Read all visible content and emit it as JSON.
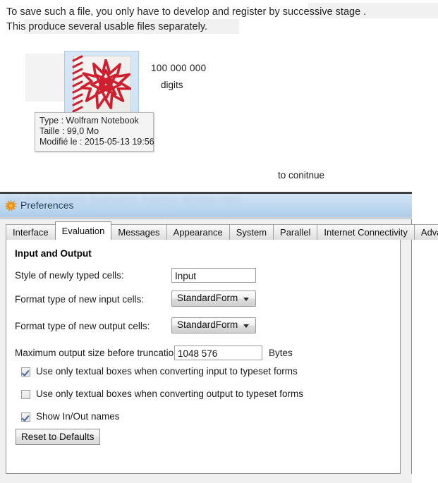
{
  "document": {
    "line1": "To save such a file, you only have to develop and register by successive stage .",
    "line2": "This produce several usable files separately.",
    "continue_note": "to conitnue"
  },
  "desktop": {
    "file_icon_name": "wolfram-notebook-icon",
    "file_count": "100 000 000",
    "file_count_unit": "digits",
    "tooltip": {
      "type": "Type : Wolfram Notebook",
      "size": "Taille : 99,0 Mo",
      "modified": "Modifié le : 2015-05-13 19:56"
    }
  },
  "prefs_window": {
    "title": "Preferences",
    "title_icon": "wolfram-spikey-icon",
    "blurred_menubar": "File   Edit   Graphics   Evaluation   Palettes   Window   Help",
    "tabs": [
      {
        "label": "Interface",
        "selected": false
      },
      {
        "label": "Evaluation",
        "selected": true
      },
      {
        "label": "Messages",
        "selected": false
      },
      {
        "label": "Appearance",
        "selected": false
      },
      {
        "label": "System",
        "selected": false
      },
      {
        "label": "Parallel",
        "selected": false
      },
      {
        "label": "Internet Connectivity",
        "selected": false
      },
      {
        "label": "Advanced",
        "selected": false
      }
    ],
    "panel": {
      "section_title": "Input and Output",
      "fields": [
        {
          "label": "Style of newly typed cells:",
          "value": "Input",
          "kind": "text"
        },
        {
          "label": "Format type of new input cells:",
          "value": "StandardForm",
          "kind": "combo"
        },
        {
          "label": "Format type of new output cells:",
          "value": "StandardForm",
          "kind": "combo"
        },
        {
          "label": "Maximum output size before truncation:",
          "value": "1048 576",
          "kind": "text",
          "unit": "Bytes"
        }
      ],
      "checkboxes": [
        {
          "label": "Use only textual boxes when converting input to typeset forms",
          "checked": true
        },
        {
          "label": "Use only textual boxes when converting output to typeset forms",
          "checked": false
        },
        {
          "label": "Show In/Out names",
          "checked": true
        }
      ],
      "reset_button": "Reset to Defaults"
    }
  },
  "colors": {
    "accent_red": "#cf1f2e",
    "accent_orange": "#f0920f",
    "title_text": "#17395c",
    "selection_blue": "#cfe2f5"
  }
}
